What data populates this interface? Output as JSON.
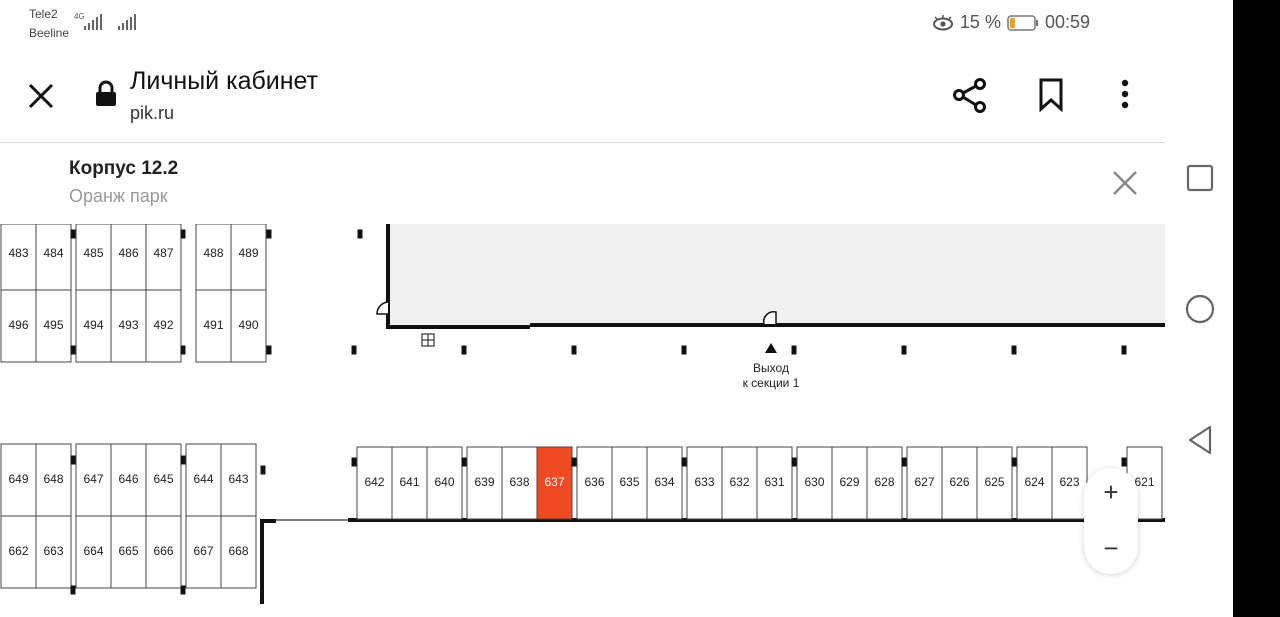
{
  "status_bar": {
    "carrier1": "Tele2",
    "carrier2": "Beeline",
    "network": "4G",
    "battery_percent": "15 %",
    "time": "00:59"
  },
  "browser": {
    "title": "Личный кабинет",
    "url": "pik.ru"
  },
  "info": {
    "building": "Корпус 12.2",
    "project": "Оранж парк"
  },
  "map": {
    "exit_label_1": "Выход",
    "exit_label_2": "к секции 1",
    "selected_space": "637",
    "selected_color": "#ef4a23",
    "rows": {
      "top_row_1": [
        "483",
        "484",
        "485",
        "486",
        "487",
        "488",
        "489"
      ],
      "top_row_2": [
        "496",
        "495",
        "494",
        "493",
        "492",
        "491",
        "490"
      ],
      "bottom_left_1": [
        "649",
        "648",
        "647",
        "646",
        "645",
        "644",
        "643"
      ],
      "bottom_left_2": [
        "662",
        "663",
        "664",
        "665",
        "666",
        "667",
        "668"
      ],
      "bottom_right": [
        "642",
        "641",
        "640",
        "639",
        "638",
        "637",
        "636",
        "635",
        "634",
        "633",
        "632",
        "631",
        "630",
        "629",
        "628",
        "627",
        "626",
        "625",
        "624",
        "623",
        "621"
      ]
    }
  },
  "zoom": {
    "plus": "+",
    "minus": "−"
  }
}
